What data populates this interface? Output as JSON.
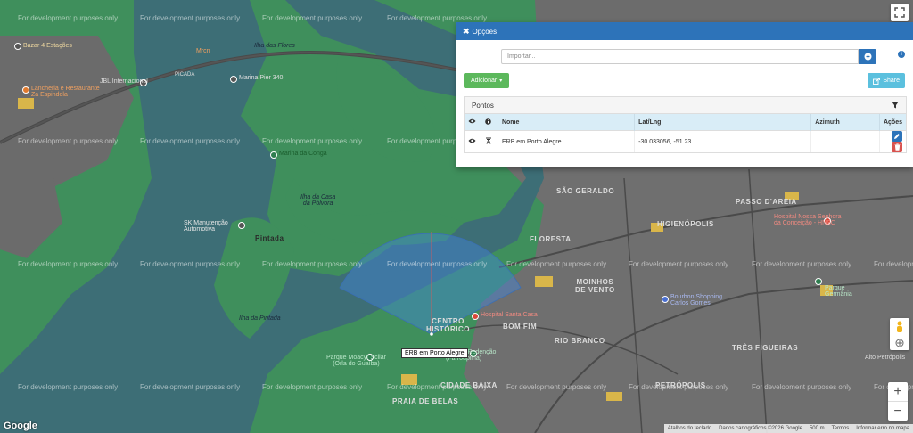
{
  "map": {
    "watermark": "For development purposes only",
    "labels": {
      "bazar": "Bazar 4 Estações",
      "lancheria": "Lancheria e Restaurante\nZa Espindola",
      "jbl": "JBL Internacional",
      "ilha_flores": "Ilha das Flores",
      "mrcn": "Mrcn",
      "marina_pier": "Marina Pier 340",
      "picada": "PICADA",
      "ilha_casa_polvora": "Ilha da Casa\nda Pólvora",
      "marina_conga": "Marina da Conga",
      "sk_manutencao": "SK Manutenção\nAutomotiva",
      "pintada": "Pintada",
      "ilha_pintada": "Ilha da Pintada",
      "sao_geraldo": "SÃO GERALDO",
      "floresta": "FLORESTA",
      "higienopolis": "HIGIENÓPOLIS",
      "passo_areia": "PASSO D'AREIA",
      "moinhos_vento": "MOINHOS\nDE VENTO",
      "centro_historico": "CENTRO\nHISTÓRICO",
      "bom_fim": "BOM FIM",
      "rio_branco": "RIO BRANCO",
      "tres_figueiras": "TRÊS FIGUEIRAS",
      "cidade_baixa": "CIDADE BAIXA",
      "praia_belas": "PRAIA DE BELAS",
      "petropolis": "PETRÓPOLIS",
      "hospital_santa_casa": "Hospital Santa Casa",
      "parque_moacyr": "Parque Moacyr Scliar\n(Orla do Guaíba)",
      "hospital_nossa_senhora": "Hospital Nossa Senhora\nda Conceição - HNSC",
      "parque_germania": "Parque\nGermânia",
      "bourbon_shopping": "Bourbon Shopping\nCarlos Gomes",
      "parque_redencao": "Parque Redenção\n(Farroupilha)",
      "alto_petropolis": "Alto Petrópolis"
    },
    "marker_label": "ERB em Porto Alegre",
    "google_logo": "Google",
    "footer": {
      "shortcuts": "Atalhos do teclado",
      "data": "Dados cartográficos ©2026 Google",
      "scale": "500 m",
      "terms": "Termos",
      "report": "Informar erro no mapa"
    },
    "zoom_in": "+",
    "zoom_out": "−"
  },
  "panel": {
    "title": "Opções",
    "close_icon": "x-icon",
    "import_placeholder": "Importar...",
    "add_label": "Adicionar",
    "share_label": "Share",
    "pontos_title": "Pontos",
    "columns": {
      "nome": "Nome",
      "latlng": "Lat/Lng",
      "azimuth": "Azimuth",
      "acoes": "Ações"
    },
    "rows": [
      {
        "nome": "ERB em Porto Alegre",
        "latlng": "-30.033056, -51.23",
        "azimuth": ""
      }
    ]
  },
  "colors": {
    "header_blue": "#2d73b9",
    "add_green": "#5cb85c",
    "share_cyan": "#5bc0de",
    "delete_red": "#d9534f",
    "map_green": "#3f8f5c",
    "water": "#3d6e76"
  }
}
